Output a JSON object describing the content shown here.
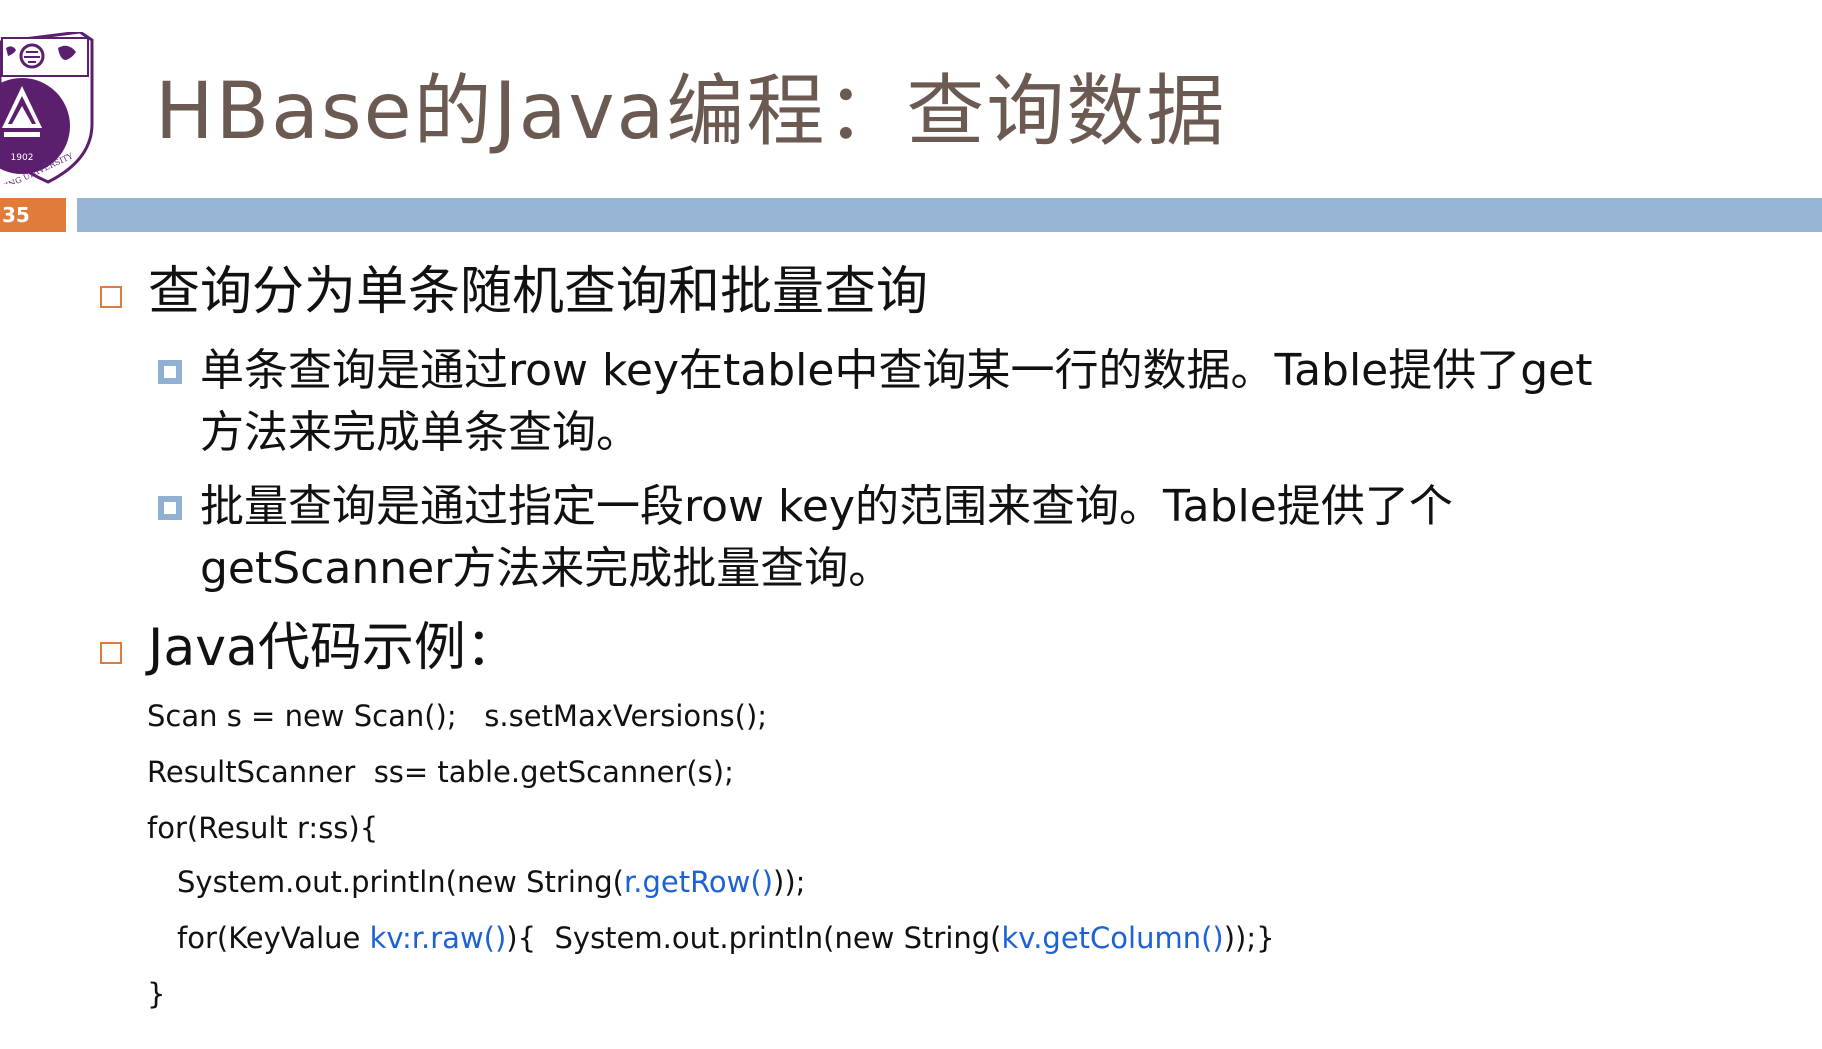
{
  "slide": {
    "number": "35",
    "title": "HBase的Java编程：查询数据"
  },
  "logo": {
    "year": "1902",
    "text": "NANJING UNIVERSITY",
    "colors": {
      "primary": "#5c1f6e",
      "accent": "#ffffff"
    }
  },
  "bullets": [
    {
      "text": "查询分为单条随机查询和批量查询",
      "sub": [
        {
          "line1": "单条查询是通过row key在table中查询某一行的数据。Table提供了get",
          "line2": "方法来完成单条查询。"
        },
        {
          "line1": "批量查询是通过指定一段row key的范围来查询。Table提供了个",
          "line2": "getScanner方法来完成批量查询。"
        }
      ]
    },
    {
      "text": "Java代码示例："
    }
  ],
  "code": {
    "line1": "Scan s = new Scan();   s.setMaxVersions();",
    "line2": "ResultScanner  ss= table.getScanner(s);",
    "line3": "for(Result r:ss){",
    "line4_a": "System.out.println(new String(",
    "line4_b": "r.getRow()",
    "line4_c": "));",
    "line5_a": "for(KeyValue ",
    "line5_b": "kv:r.raw()",
    "line5_c": "){  System.out.println(new String(",
    "line5_d": "kv.getColumn()",
    "line5_e": "));}",
    "line6": "}"
  },
  "colors": {
    "title": "#6b5a52",
    "title_bar": "#96b4d3",
    "slide_number_bg": "#e07b3a",
    "code_highlight": "#1c62d6"
  }
}
